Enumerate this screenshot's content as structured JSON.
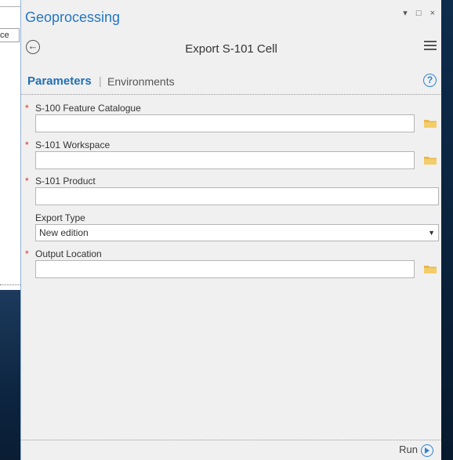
{
  "background": {
    "left_panel_fragment": "ce"
  },
  "pane": {
    "title": "Geoprocessing",
    "controls": [
      "▾",
      "□",
      "×"
    ]
  },
  "tool": {
    "title": "Export S-101 Cell"
  },
  "tabs": {
    "active": "Parameters",
    "separator": "|",
    "other": "Environments",
    "help": "?"
  },
  "parameters": [
    {
      "label": "S-100 Feature Catalogue",
      "required": true,
      "value": "",
      "browse": true
    },
    {
      "label": "S-101 Workspace",
      "required": true,
      "value": "",
      "browse": true
    },
    {
      "label": "S-101 Product",
      "required": true,
      "value": "",
      "browse": false
    },
    {
      "label": "Export Type",
      "required": false,
      "value": "New edition"
    },
    {
      "label": "Output Location",
      "required": true,
      "value": "",
      "browse": true
    }
  ],
  "required_marker": "*",
  "footer": {
    "run_label": "Run"
  },
  "colors": {
    "accent": "#2477c0",
    "required": "#d0342c",
    "folder": "#e8b84a"
  }
}
